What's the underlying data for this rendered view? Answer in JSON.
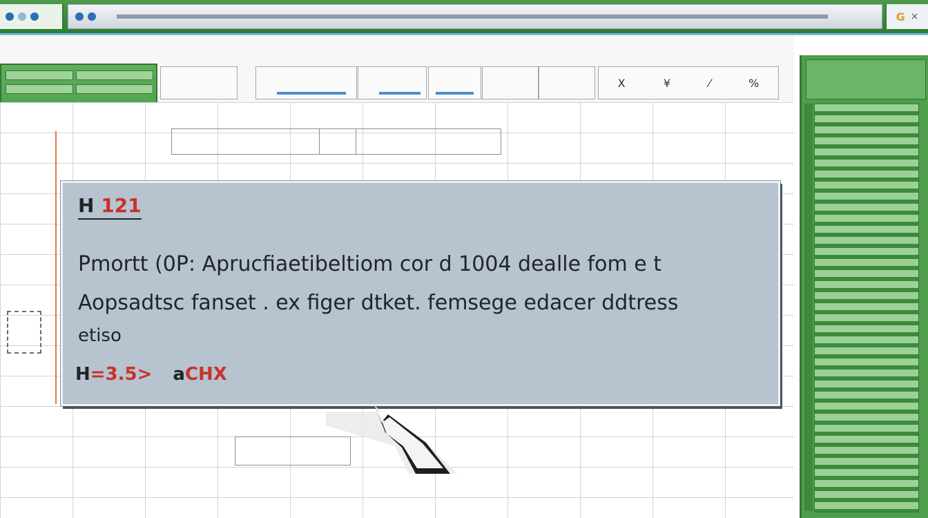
{
  "window": {
    "right_logo": "G",
    "close_glyph": "×"
  },
  "ribbon": {
    "tabs": [
      "X",
      "¥",
      "⁄",
      "%"
    ]
  },
  "tooltip": {
    "heading_prefix": "H",
    "heading_number": "121",
    "line1": "Pmortt  (0P: Aprucfiaetibeltiom cor d 1004  dealle fom e t",
    "line2": "Aopsadtsc fanset .  ex figer dtket.  femsege edacer ddtress",
    "line3": "etiso",
    "footer_left_dark": "H",
    "footer_left_red": "=3.5>",
    "footer_right_dark": "a",
    "footer_right_red": "CHX"
  },
  "colors": {
    "accent_green": "#4f9d4d",
    "tooltip_bg": "#b7c3ce",
    "error_red": "#c8322a"
  }
}
